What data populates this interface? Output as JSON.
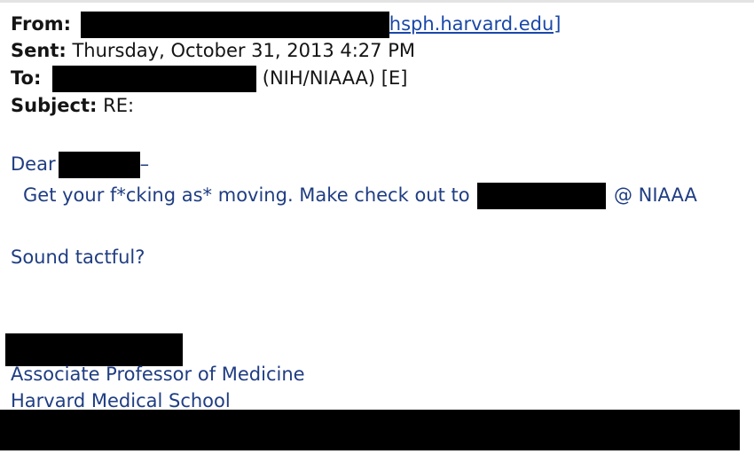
{
  "email": {
    "header": {
      "from_label": "From:",
      "from_domain": "hsph.harvard.edu]",
      "sent_label": "Sent:",
      "sent_value": "Thursday, October 31, 2013 4:27 PM",
      "to_label": "To:",
      "to_org": "(NIH/NIAAA) [E]",
      "subject_label": "Subject:",
      "subject_value": "RE:"
    },
    "body": {
      "greeting": "Dear",
      "greeting_dash": "–",
      "line1": "Get your f*cking as* moving. Make check out to",
      "line1_suffix": "@ NIAAA",
      "line2": "Sound tactful?"
    },
    "signature": {
      "title": "Associate Professor of Medicine",
      "institution": "Harvard Medical School"
    }
  },
  "colors": {
    "header_text": "#141414",
    "body_text": "#1f3d82",
    "link": "#1a48a8",
    "redaction": "#000000"
  }
}
